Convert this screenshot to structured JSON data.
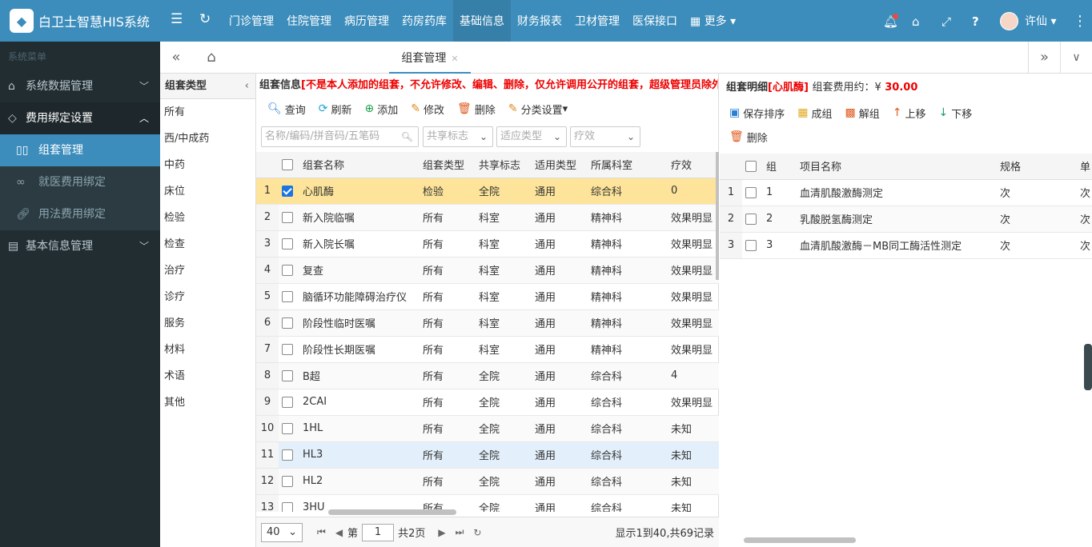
{
  "app": {
    "title": "白卫士智慧HIS系统"
  },
  "topnav": [
    "门诊管理",
    "住院管理",
    "病历管理",
    "药房药库",
    "基础信息",
    "财务报表",
    "卫材管理",
    "医保接口",
    "更多"
  ],
  "user": {
    "name": "许仙"
  },
  "sidebar": {
    "header": "系统菜单",
    "items": [
      {
        "label": "系统数据管理"
      },
      {
        "label": "费用绑定设置"
      },
      {
        "label": "组套管理"
      },
      {
        "label": "就医费用绑定"
      },
      {
        "label": "用法费用绑定"
      },
      {
        "label": "基本信息管理"
      }
    ]
  },
  "tab": {
    "label": "组套管理"
  },
  "category": {
    "title": "组套类型",
    "items": [
      "所有",
      "西/中成药",
      "中药",
      "床位",
      "检验",
      "检查",
      "治疗",
      "诊疗",
      "服务",
      "材料",
      "术语",
      "其他"
    ]
  },
  "group": {
    "title": "组套信息",
    "notice": "[不是本人添加的组套，不允许修改、编辑、删除，仅允许调用公开的组套，超级管理员除外]",
    "toolbar": [
      "查询",
      "刷新",
      "添加",
      "修改",
      "删除",
      "分类设置"
    ],
    "filters": {
      "search_placeholder": "名称/编码/拼音码/五笔码",
      "share": "共享标志",
      "type": "适应类型",
      "effect": "疗效"
    },
    "columns": [
      "组套名称",
      "组套类型",
      "共享标志",
      "适用类型",
      "所属科室",
      "疗效"
    ],
    "rows": [
      {
        "n": "1",
        "name": "心肌酶",
        "type": "检验",
        "share": "全院",
        "use": "通用",
        "dept": "综合科",
        "effect": "0"
      },
      {
        "n": "2",
        "name": "新入院临嘱",
        "type": "所有",
        "share": "科室",
        "use": "通用",
        "dept": "精神科",
        "effect": "效果明显"
      },
      {
        "n": "3",
        "name": "新入院长嘱",
        "type": "所有",
        "share": "科室",
        "use": "通用",
        "dept": "精神科",
        "effect": "效果明显"
      },
      {
        "n": "4",
        "name": "复查",
        "type": "所有",
        "share": "科室",
        "use": "通用",
        "dept": "精神科",
        "effect": "效果明显"
      },
      {
        "n": "5",
        "name": "脑循环功能障碍治疗仪",
        "type": "所有",
        "share": "科室",
        "use": "通用",
        "dept": "精神科",
        "effect": "效果明显"
      },
      {
        "n": "6",
        "name": "阶段性临时医嘱",
        "type": "所有",
        "share": "科室",
        "use": "通用",
        "dept": "精神科",
        "effect": "效果明显"
      },
      {
        "n": "7",
        "name": "阶段性长期医嘱",
        "type": "所有",
        "share": "科室",
        "use": "通用",
        "dept": "精神科",
        "effect": "效果明显"
      },
      {
        "n": "8",
        "name": "B超",
        "type": "所有",
        "share": "全院",
        "use": "通用",
        "dept": "综合科",
        "effect": "4"
      },
      {
        "n": "9",
        "name": "2CAI",
        "type": "所有",
        "share": "全院",
        "use": "通用",
        "dept": "综合科",
        "effect": "效果明显"
      },
      {
        "n": "10",
        "name": "1HL",
        "type": "所有",
        "share": "全院",
        "use": "通用",
        "dept": "综合科",
        "effect": "未知"
      },
      {
        "n": "11",
        "name": "HL3",
        "type": "所有",
        "share": "全院",
        "use": "通用",
        "dept": "综合科",
        "effect": "未知"
      },
      {
        "n": "12",
        "name": "HL2",
        "type": "所有",
        "share": "全院",
        "use": "通用",
        "dept": "综合科",
        "effect": "未知"
      },
      {
        "n": "13",
        "name": "3HU",
        "type": "所有",
        "share": "全院",
        "use": "通用",
        "dept": "综合科",
        "effect": "未知"
      }
    ],
    "pager": {
      "size": "40",
      "page_label": "第",
      "page": "1",
      "total_pages": "共2页",
      "summary": "显示1到40,共69记录"
    }
  },
  "detail": {
    "title": "组套明细",
    "name": "[心肌酶]",
    "cost_label": "组套费用约：¥",
    "cost": "30.00",
    "toolbar": [
      "保存排序",
      "成组",
      "解组",
      "上移",
      "下移",
      "删除"
    ],
    "columns": [
      "组",
      "项目名称",
      "规格",
      "单"
    ],
    "rows": [
      {
        "n": "1",
        "g": "1",
        "name": "血清肌酸激酶测定",
        "spec": "次",
        "unit": "次"
      },
      {
        "n": "2",
        "g": "2",
        "name": "乳酸脱氢酶测定",
        "spec": "次",
        "unit": "次"
      },
      {
        "n": "3",
        "g": "3",
        "name": "血清肌酸激酶－MB同工酶活性测定",
        "spec": "次",
        "unit": "次"
      }
    ]
  },
  "colors": {
    "primary": "#3c8dbc",
    "sidebar": "#222d32",
    "notice": "#e00000",
    "selected_row": "#fde49a"
  }
}
